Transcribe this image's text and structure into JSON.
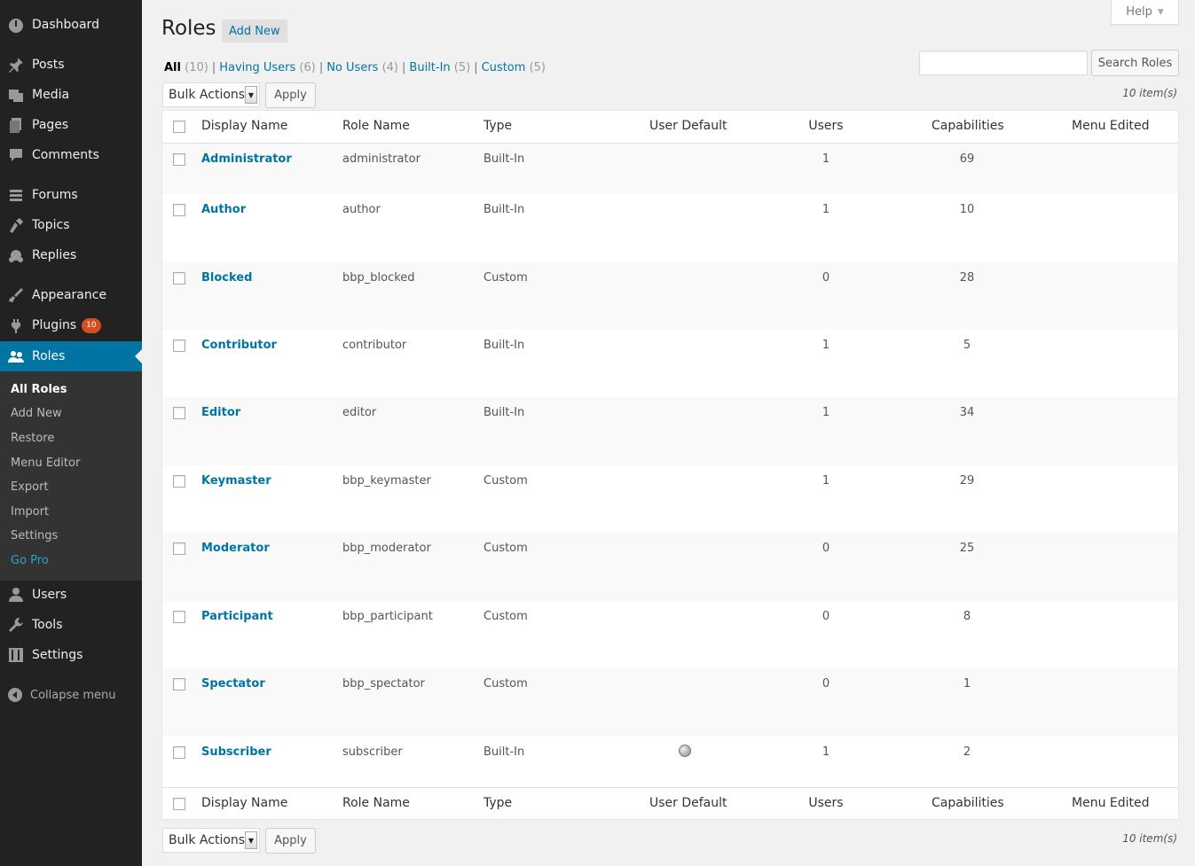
{
  "sidebar": {
    "menu": [
      {
        "label": "Dashboard",
        "icon": "dashboard-icon"
      },
      {
        "label": "Posts",
        "icon": "pin-icon"
      },
      {
        "label": "Media",
        "icon": "media-icon"
      },
      {
        "label": "Pages",
        "icon": "pages-icon"
      },
      {
        "label": "Comments",
        "icon": "comment-icon"
      },
      {
        "label": "Forums",
        "icon": "forums-icon"
      },
      {
        "label": "Topics",
        "icon": "topics-icon"
      },
      {
        "label": "Replies",
        "icon": "replies-icon"
      },
      {
        "label": "Appearance",
        "icon": "brush-icon"
      },
      {
        "label": "Plugins",
        "icon": "plugin-icon",
        "badge": "10"
      },
      {
        "label": "Roles",
        "icon": "users-group-icon"
      },
      {
        "label": "Users",
        "icon": "user-icon"
      },
      {
        "label": "Tools",
        "icon": "wrench-icon"
      },
      {
        "label": "Settings",
        "icon": "settings-icon"
      }
    ],
    "submenu": [
      "All Roles",
      "Add New",
      "Restore",
      "Menu Editor",
      "Export",
      "Import",
      "Settings",
      "Go Pro"
    ],
    "collapse_label": "Collapse menu"
  },
  "header": {
    "help_label": "Help",
    "title": "Roles",
    "add_new_label": "Add New"
  },
  "filters": [
    {
      "label": "All",
      "count": "(10)"
    },
    {
      "label": "Having Users",
      "count": "(6)"
    },
    {
      "label": "No Users",
      "count": "(4)"
    },
    {
      "label": "Built-In",
      "count": "(5)"
    },
    {
      "label": "Custom",
      "count": "(5)"
    }
  ],
  "search": {
    "button_label": "Search Roles",
    "value": ""
  },
  "bulk": {
    "select_label": "Bulk Actions",
    "apply_label": "Apply",
    "items_count": "10 item(s)"
  },
  "table": {
    "columns": [
      "Display Name",
      "Role Name",
      "Type",
      "User Default",
      "Users",
      "Capabilities",
      "Menu Edited"
    ],
    "rows": [
      {
        "display": "Administrator",
        "role": "administrator",
        "type": "Built-In",
        "default": false,
        "users": "1",
        "caps": "69"
      },
      {
        "display": "Author",
        "role": "author",
        "type": "Built-In",
        "default": false,
        "users": "1",
        "caps": "10"
      },
      {
        "display": "Blocked",
        "role": "bbp_blocked",
        "type": "Custom",
        "default": false,
        "users": "0",
        "caps": "28"
      },
      {
        "display": "Contributor",
        "role": "contributor",
        "type": "Built-In",
        "default": false,
        "users": "1",
        "caps": "5"
      },
      {
        "display": "Editor",
        "role": "editor",
        "type": "Built-In",
        "default": false,
        "users": "1",
        "caps": "34"
      },
      {
        "display": "Keymaster",
        "role": "bbp_keymaster",
        "type": "Custom",
        "default": false,
        "users": "1",
        "caps": "29"
      },
      {
        "display": "Moderator",
        "role": "bbp_moderator",
        "type": "Custom",
        "default": false,
        "users": "0",
        "caps": "25"
      },
      {
        "display": "Participant",
        "role": "bbp_participant",
        "type": "Custom",
        "default": false,
        "users": "0",
        "caps": "8"
      },
      {
        "display": "Spectator",
        "role": "bbp_spectator",
        "type": "Custom",
        "default": false,
        "users": "0",
        "caps": "1"
      },
      {
        "display": "Subscriber",
        "role": "subscriber",
        "type": "Built-In",
        "default": true,
        "users": "1",
        "caps": "2"
      }
    ]
  },
  "colors": {
    "sidebar_bg": "#222222",
    "submenu_bg": "#333333",
    "accent": "#0074a2",
    "link": "#0074a2",
    "badge": "#d54e21"
  }
}
